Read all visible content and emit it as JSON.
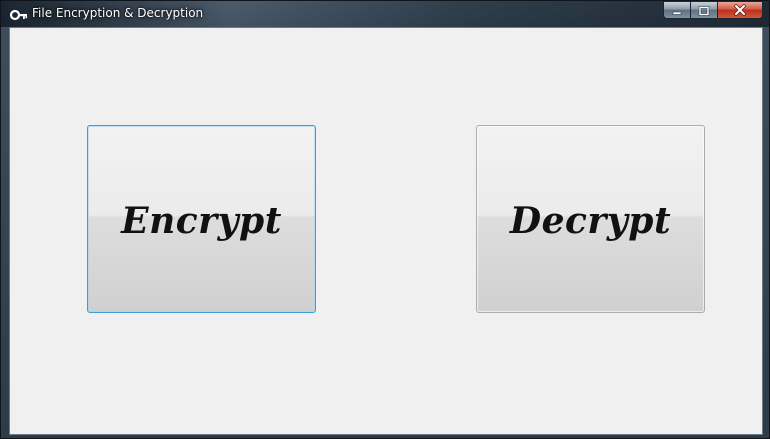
{
  "window": {
    "title": "File Encryption & Decryption",
    "icon": "key-icon"
  },
  "caption_buttons": {
    "minimize_icon": "minimize-icon",
    "maximize_icon": "maximize-icon",
    "close_icon": "close-icon"
  },
  "buttons": {
    "encrypt_label": "Encrypt",
    "decrypt_label": "Decrypt"
  },
  "colors": {
    "focus_border": "#3c9ed8",
    "client_background": "#f0f0f0",
    "close_button": "#c7402a"
  }
}
